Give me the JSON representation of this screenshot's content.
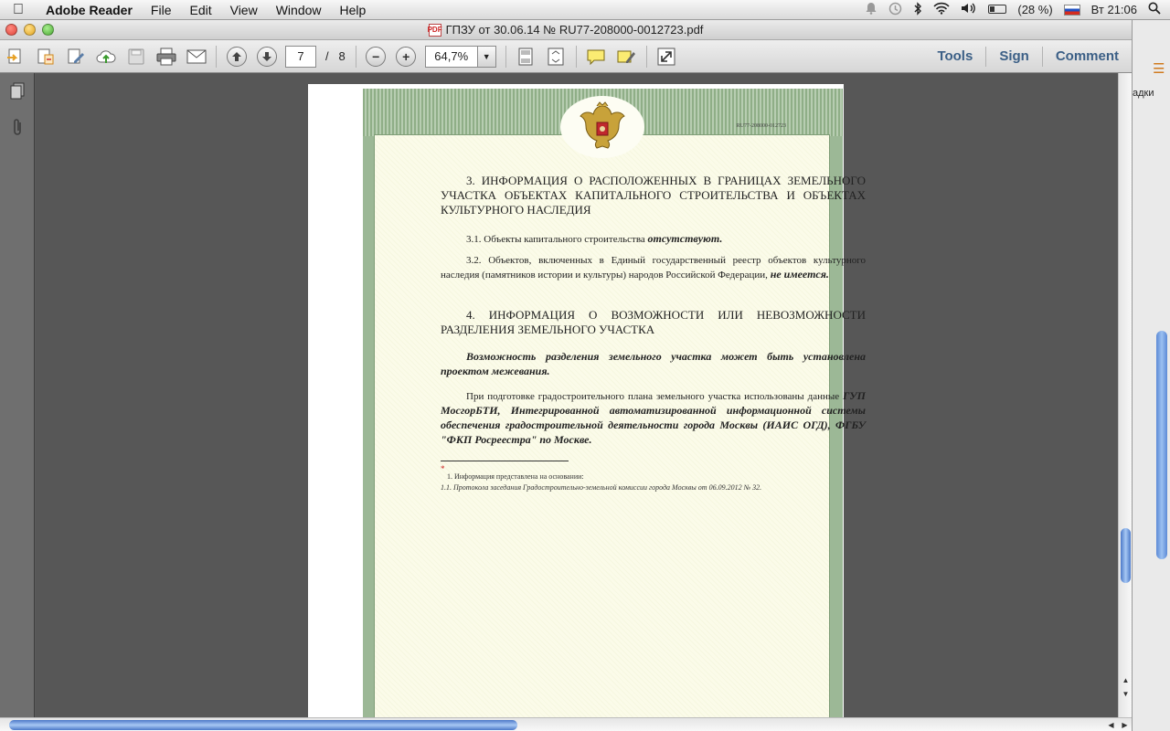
{
  "menubar": {
    "app_name": "Adobe Reader",
    "items": [
      "File",
      "Edit",
      "View",
      "Window",
      "Help"
    ],
    "battery": "(28 %)",
    "clock": "Вт 21:06"
  },
  "window": {
    "title": "ГПЗУ от 30.06.14 № RU77-208000-0012723.pdf"
  },
  "toolbar": {
    "current_page": "7",
    "page_separator": "/",
    "total_pages": "8",
    "zoom": "64,7%",
    "tools_label": "Tools",
    "sign_label": "Sign",
    "comment_label": "Comment"
  },
  "right_panel": {
    "peek_text": "адки"
  },
  "document": {
    "cert_number": "RU77-208000-012723",
    "section3_heading": "3. ИНФОРМАЦИЯ О РАСПОЛОЖЕННЫХ В ГРАНИЦАХ ЗЕМЕЛЬНОГО УЧАСТКА ОБЪЕКТАХ КАПИТАЛЬНОГО СТРОИТЕЛЬСТВА И ОБЪЕКТАХ КУЛЬТУРНОГО НАСЛЕДИЯ",
    "p31_text": "3.1. Объекты капитального строительства ",
    "p31_bold": "отсутствуют.",
    "p32_text": "3.2. Объектов, включенных в Единый государственный реестр объектов культурного наследия (памятников истории и культуры) народов Российской Федерации, ",
    "p32_bold": "не имеется.",
    "section4_heading": "4. ИНФОРМАЦИЯ О ВОЗМОЖНОСТИ ИЛИ НЕВОЗМОЖНОСТИ РАЗДЕЛЕНИЯ ЗЕМЕЛЬНОГО УЧАСТКА",
    "section4_bold": "Возможность разделения земельного участка может быть установлена проектом межевания.",
    "prep_text": "При подготовке градостроительного плана земельного участка использованы данные ",
    "prep_bold": "ГУП МосгорБТИ, Интегрированной автоматизированной информационной системы обеспечения градостроительной деятельности города Москвы (ИАИС ОГД), ФГБУ \"ФКП Росреестра\" по Москве.",
    "footnote_marker": "*",
    "footnote_1": "1. Информация представлена на основании:",
    "footnote_2": "1.1. Протокола заседания Градостроительно-земельной комиссии города Москвы от 06.09.2012 № 32."
  }
}
